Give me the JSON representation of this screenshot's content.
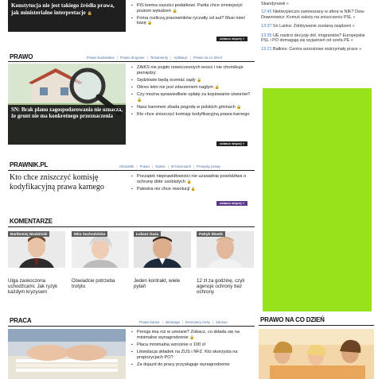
{
  "top": {
    "headline": "Konstytucja nie jest takiego źródła prawa, jak ministerialne interpretacje",
    "bullets": [
      "PiS kontra oszuści podatkowi. Partia chce zmniejszyć poziom wyłudzeń",
      "Firma rozliczą pracowników ryczałty od aut? Musi mieć kasę"
    ],
    "more": "zobacz więcej »"
  },
  "right_news": [
    {
      "time": "",
      "text": "Skandynawii »"
    },
    {
      "time": "12:45",
      "text": "Niebezpieczni zamieszany w aferę w NIK? Dwa-Drawnowicz: Komuś zależy na zniszczeniu PSL »"
    },
    {
      "time": "13:37",
      "text": "Sri Lanka: Zdobywanie zostaną osądzeni »"
    },
    {
      "time": "13:35",
      "text": "UE nastroi decyzję dot. imigrantów? Europejskie PSL i PO domagają się wyjaśnień od szefa PE »"
    },
    {
      "time": "13:21",
      "text": "Bałkins: Centra wzrostowe wstrzymały prace »"
    }
  ],
  "prawo": {
    "title": "PRAWO",
    "nav": [
      "Prawo budowlane",
      "Prawo drogowe",
      "Testamenty",
      "Aplikacje",
      "Prawo na co dzień"
    ],
    "image_headline": "SN: Brak planu zagospodarowania nie oznacza, że grunt nie ma konkretnego przeznaczenia",
    "bullets": [
      "ZAiKS nie pojęło nowoczesnych wosci i nie chomikuje pieniędzy",
      "Sędziowie będą oceniać sądy",
      "Okres letni nie jest zdarzeniem nagłym",
      "Czy można sprawiedliwie opłatę za kopiowanie utworów?",
      "Nasz barometr zbada pogodę w polskich gminach",
      "Kto chce zniszczyć komisję kodyfikacyjną prawa karnego"
    ],
    "more": "zobacz więcej »"
  },
  "prawnik": {
    "title": "PRAWNIK.PL",
    "nav": [
      "Obsoletki",
      "Prawo",
      "Opinie",
      "W biznesach",
      "Przepisy prawy"
    ],
    "headline": "Kto chce zniszczyć komisję kodyfikacyjną prawa karnego",
    "bullets": [
      "Początek nieprawidłowości nie uzasadnia powództwa o ochronę dóbr osobistych",
      "Palestra nie chce rewolucji"
    ],
    "more": "zobacz więcej »"
  },
  "komentarze": {
    "title": "KOMENTARZE",
    "authors": [
      {
        "name": "Bartłomiej Niedziński",
        "text": "Ulga zaskoczona uchodźcami. Jak ryzyk każdym kryzysem"
      },
      {
        "name": "Mira Suchodolska",
        "text": "Oświadcie potrzeba trotytu"
      },
      {
        "name": "Łukasz Guza",
        "text": "Jeden kontrakt, wiele pytań"
      },
      {
        "name": "Patryk Słowik",
        "text": "12 zł za godzinę, czyli agencje ochrony bez ochrony"
      }
    ]
  },
  "praca": {
    "title": "PRACA",
    "nav": [
      "Prawo karnie",
      "Idziaraga",
      "Emerytury renty",
      "Zdrowo"
    ],
    "bullets": [
      "Pensja ima niż w umowie? Zobacz, co składa się na minimalne wynagrodzenie",
      "Płaca minimalna wzrośnie o 100 zł",
      "Likwidacja składek na ZUS i NFZ. Kto skorzysta na propozycjach PO?",
      "Za dojazd do pracy przysługuje wynagrodzenie"
    ]
  },
  "prawo_na_co_dzien": {
    "title": "PRAWO NA CO DZIEŃ"
  },
  "colors": {
    "ad_green": "#98e21a",
    "dark_box": "#1f1f1f",
    "link_blue": "#4a6fa5",
    "time_blue": "#3b79c2",
    "purple_btn": "#5b3a8a"
  }
}
